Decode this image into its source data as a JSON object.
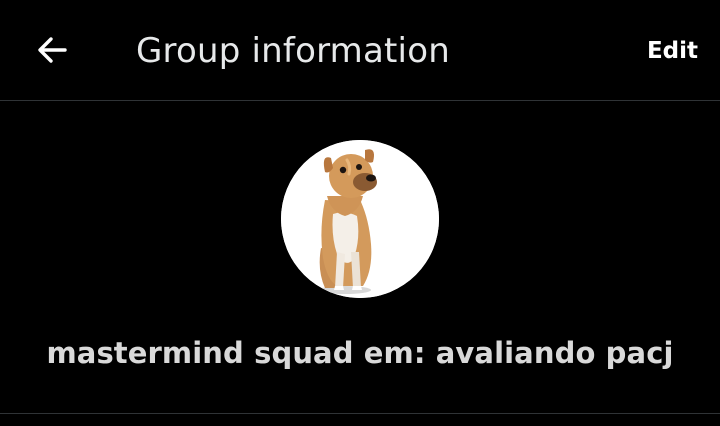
{
  "header": {
    "title": "Group information",
    "edit_label": "Edit",
    "back_icon": "arrow-left-icon"
  },
  "group": {
    "name": "mastermind squad em: avaliando pacj",
    "avatar_subject": "dog-photo"
  },
  "colors": {
    "background": "#000000",
    "text_primary": "#e7e9ea",
    "divider": "#2f3336",
    "avatar_bg": "#ffffff"
  }
}
